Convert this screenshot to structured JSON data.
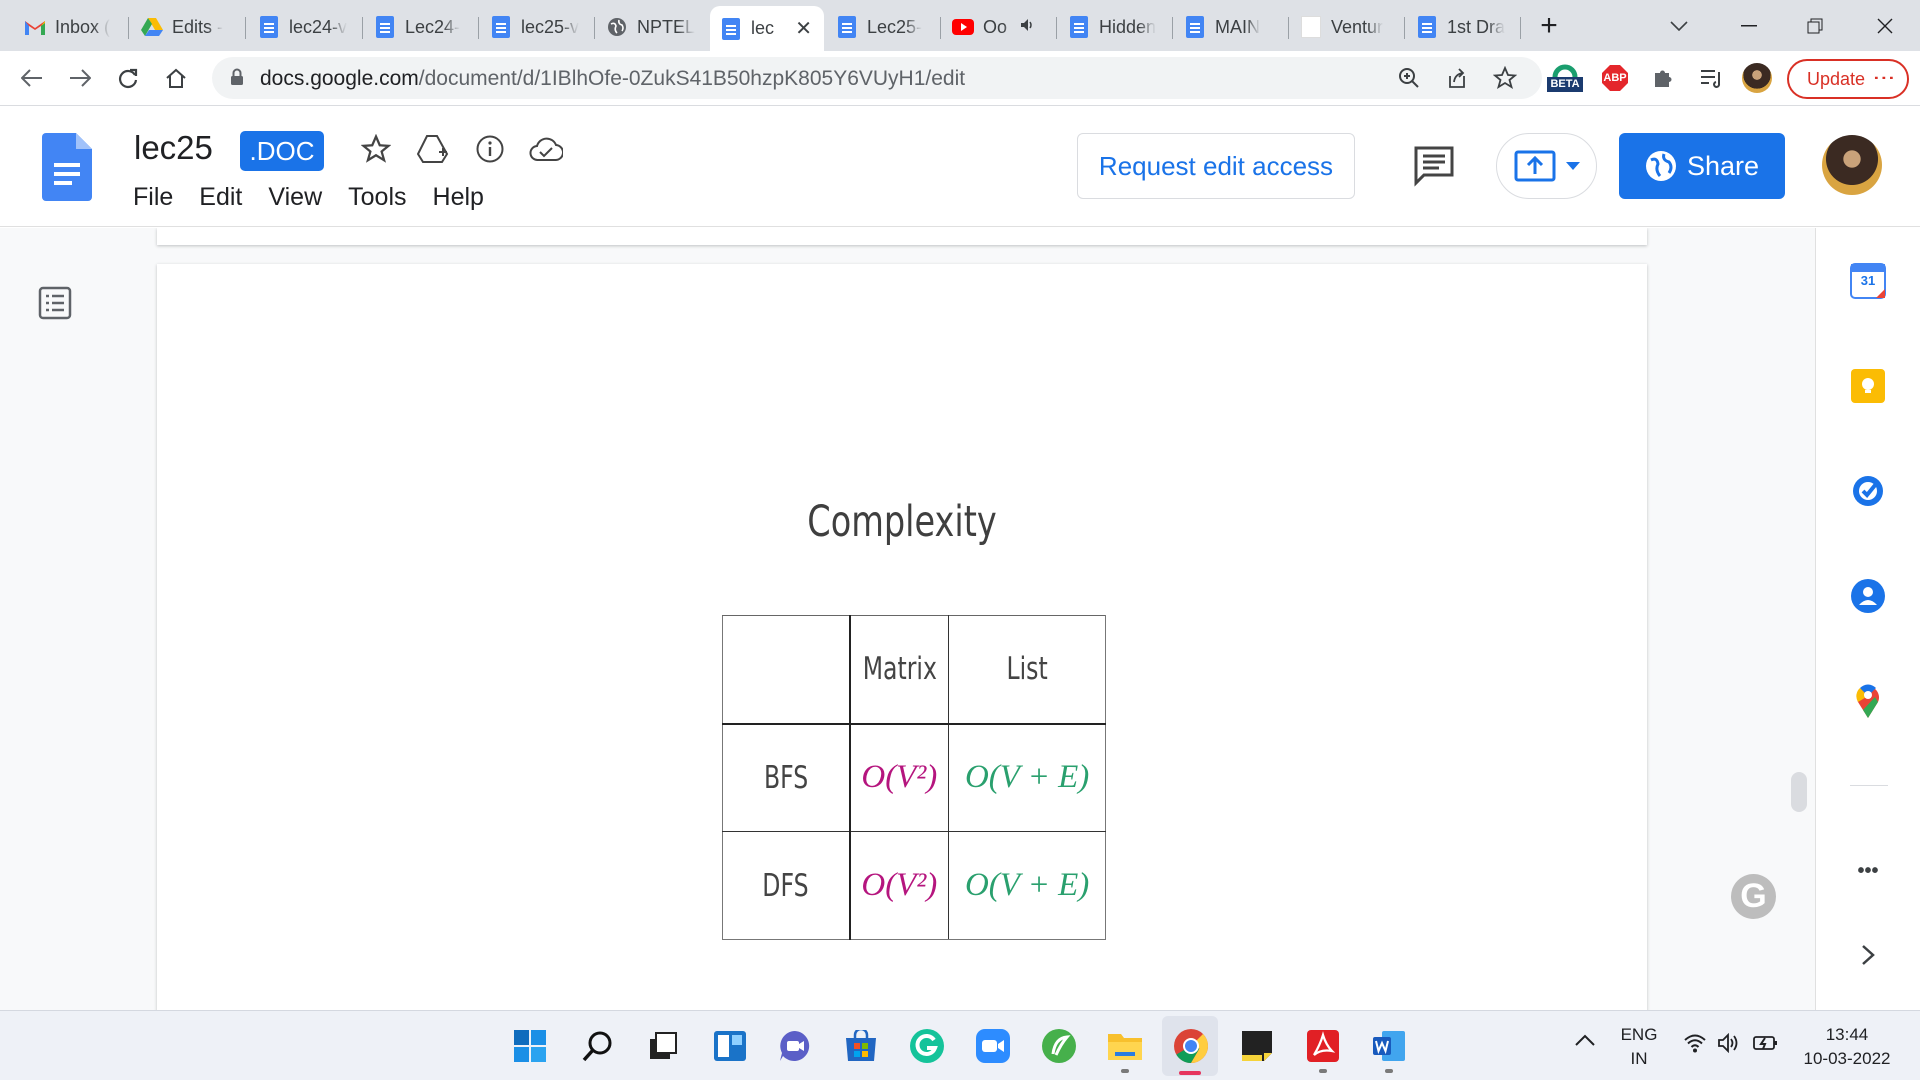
{
  "browser": {
    "tabs": [
      {
        "title": "Inbox (",
        "icon": "gmail-icon"
      },
      {
        "title": "Edits -",
        "icon": "drive-icon"
      },
      {
        "title": "lec24-v",
        "icon": "docs-icon"
      },
      {
        "title": "Lec24-",
        "icon": "docs-icon"
      },
      {
        "title": "lec25-v",
        "icon": "docs-icon"
      },
      {
        "title": "NPTEL",
        "icon": "globe-icon"
      },
      {
        "title": "lec",
        "icon": "docs-icon"
      },
      {
        "title": "Lec25-",
        "icon": "docs-icon"
      },
      {
        "title": "Oo",
        "icon": "youtube-icon"
      },
      {
        "title": "Hidden",
        "icon": "docs-icon"
      },
      {
        "title": "MAIN",
        "icon": "docs-icon"
      },
      {
        "title": "Ventur",
        "icon": "blank-page-icon"
      },
      {
        "title": "1st Dra",
        "icon": "docs-icon"
      }
    ],
    "url_host": "docs.google.com",
    "url_path": "/document/d/1IBlhOfe-0ZukS41B50hzpK805Y6VUyH1/edit",
    "ext_beta_label": "BETA",
    "ext_abp_label": "ABP",
    "update_label": "Update"
  },
  "docs": {
    "title": "lec25",
    "badge": ".DOC",
    "menu": [
      "File",
      "Edit",
      "View",
      "Tools",
      "Help"
    ],
    "request_edit_label": "Request edit access",
    "share_label": "Share"
  },
  "content": {
    "slide_title": "Complexity",
    "table": {
      "headers": [
        "",
        "Matrix",
        "List"
      ],
      "rows": [
        {
          "label": "BFS",
          "matrix": "O(V²)",
          "list": "O(V + E)"
        },
        {
          "label": "DFS",
          "matrix": "O(V²)",
          "list": "O(V + E)"
        }
      ]
    }
  },
  "sidepanel": {
    "calendar_day": "31",
    "more_label": "•••"
  },
  "taskbar": {
    "lang_top": "ENG",
    "lang_bottom": "IN",
    "time": "13:44",
    "date": "10-03-2022"
  },
  "colors": {
    "accent": "#1a73e8",
    "matrix_entry": "#b5157e",
    "list_entry": "#2aa06e",
    "update_red": "#d93025"
  }
}
